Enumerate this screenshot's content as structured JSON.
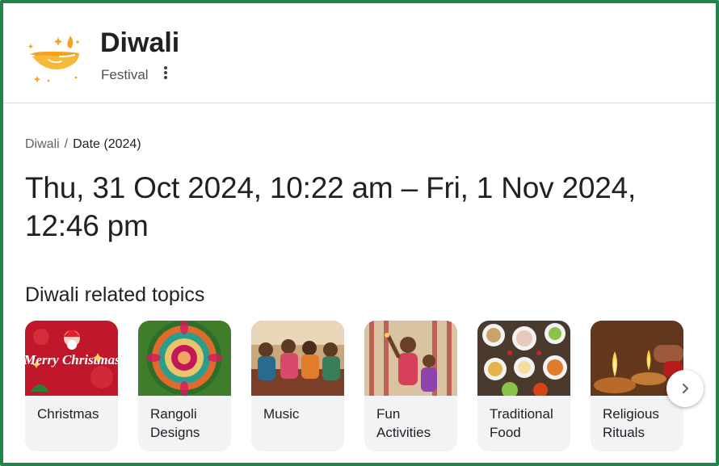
{
  "header": {
    "title": "Diwali",
    "subtitle": "Festival",
    "logo_icon": "diya-lamp-icon",
    "more_icon": "more-vert-icon"
  },
  "breadcrumb": {
    "root": "Diwali",
    "separator": "/",
    "current": "Date (2024)"
  },
  "answer": {
    "text": "Thu, 31 Oct 2024, 10:22 am – Fri, 1 Nov 2024, 12:46 pm"
  },
  "related": {
    "heading": "Diwali related topics",
    "cards": [
      {
        "label": "Christmas",
        "thumb": "Merry Christmas"
      },
      {
        "label": "Rangoli Designs"
      },
      {
        "label": "Music"
      },
      {
        "label": "Fun Activities"
      },
      {
        "label": "Traditional Food"
      },
      {
        "label": "Religious Rituals"
      }
    ],
    "next_icon": "chevron-right-icon"
  },
  "colors": {
    "frame_border": "#1e8449",
    "logo_orange": "#f4a21c",
    "card_bg": "#f1f3f4"
  }
}
